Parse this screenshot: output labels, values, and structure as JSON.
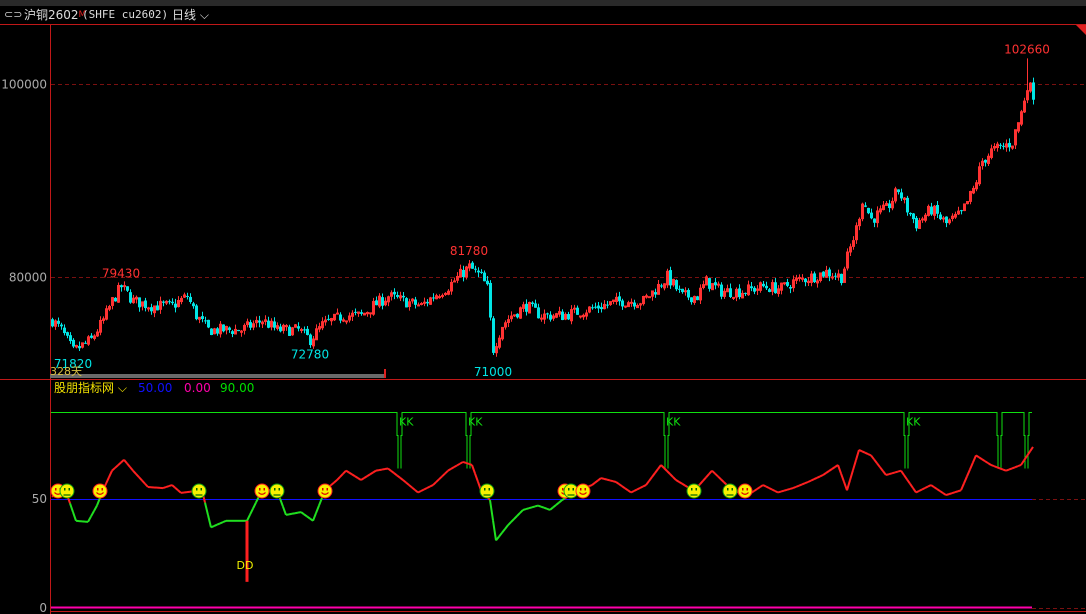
{
  "header": {
    "link_icon": "link-icon",
    "name": "沪铜2602",
    "flag": "M",
    "code": "(SHFE cu2602)",
    "period": "日线",
    "period_icon": "chevron-down-icon"
  },
  "main_chart": {
    "type": "candlestick",
    "y_ticks": [
      {
        "label": "100000",
        "value": 100000
      },
      {
        "label": "80000",
        "value": 80000
      }
    ],
    "ylim": [
      70500,
      103500
    ],
    "days": 328,
    "day_count_label": "328天",
    "colors": {
      "up": "#ff3232",
      "down": "#00e5e5",
      "grid": "#7a1010",
      "axis": "#c01818"
    },
    "annotations": [
      {
        "label": "79430",
        "day": 23,
        "value": 79430,
        "color": "#ff3232"
      },
      {
        "label": "71820",
        "day": 7,
        "value": 71820,
        "color": "#00e5e5"
      },
      {
        "label": "72780",
        "day": 86,
        "value": 72780,
        "color": "#00e5e5"
      },
      {
        "label": "81780",
        "day": 139,
        "value": 81780,
        "color": "#ff3232"
      },
      {
        "label": "71000",
        "day": 147,
        "value": 71000,
        "color": "#00e5e5"
      },
      {
        "label": "102660",
        "day": 325,
        "value": 102660,
        "color": "#ff3232"
      }
    ],
    "close_path": [
      [
        0,
        75500
      ],
      [
        3,
        74500
      ],
      [
        7,
        72300
      ],
      [
        13,
        73500
      ],
      [
        17,
        75500
      ],
      [
        20,
        77500
      ],
      [
        23,
        79000
      ],
      [
        27,
        77500
      ],
      [
        33,
        77000
      ],
      [
        40,
        77000
      ],
      [
        45,
        78000
      ],
      [
        48,
        76000
      ],
      [
        52,
        74500
      ],
      [
        57,
        74500
      ],
      [
        63,
        74500
      ],
      [
        70,
        75500
      ],
      [
        75,
        74500
      ],
      [
        82,
        74500
      ],
      [
        86,
        73500
      ],
      [
        90,
        75000
      ],
      [
        97,
        76000
      ],
      [
        103,
        76000
      ],
      [
        107,
        77000
      ],
      [
        112,
        78000
      ],
      [
        117,
        77500
      ],
      [
        123,
        77000
      ],
      [
        127,
        78000
      ],
      [
        132,
        79000
      ],
      [
        137,
        80500
      ],
      [
        139,
        81000
      ],
      [
        143,
        80000
      ],
      [
        145,
        78800
      ],
      [
        146,
        75500
      ],
      [
        147,
        72500
      ],
      [
        150,
        75000
      ],
      [
        153,
        76000
      ],
      [
        158,
        77000
      ],
      [
        163,
        76000
      ],
      [
        170,
        76000
      ],
      [
        177,
        76500
      ],
      [
        183,
        77000
      ],
      [
        190,
        77500
      ],
      [
        197,
        77500
      ],
      [
        202,
        79000
      ],
      [
        205,
        80000
      ],
      [
        210,
        78000
      ],
      [
        215,
        78000
      ],
      [
        218,
        79500
      ],
      [
        223,
        78500
      ],
      [
        230,
        78500
      ],
      [
        237,
        79000
      ],
      [
        243,
        78800
      ],
      [
        247,
        79500
      ],
      [
        253,
        80000
      ],
      [
        258,
        80500
      ],
      [
        263,
        80000
      ],
      [
        265,
        82000
      ],
      [
        268,
        85000
      ],
      [
        270,
        88000
      ],
      [
        273,
        86000
      ],
      [
        278,
        87000
      ],
      [
        282,
        89000
      ],
      [
        285,
        87000
      ],
      [
        288,
        85500
      ],
      [
        293,
        87000
      ],
      [
        298,
        85500
      ],
      [
        303,
        86500
      ],
      [
        307,
        89000
      ],
      [
        310,
        92000
      ],
      [
        313,
        93000
      ],
      [
        317,
        93500
      ],
      [
        320,
        94000
      ],
      [
        323,
        97000
      ],
      [
        325,
        100000
      ],
      [
        327,
        99000
      ]
    ]
  },
  "indicator": {
    "name": "股朋指标网",
    "dropdown_icon": "chevron-down-icon",
    "params": [
      {
        "value": "50.00",
        "color": "#1010ff"
      },
      {
        "value": "0.00",
        "color": "#ff00aa"
      },
      {
        "value": "90.00",
        "color": "#00e000"
      }
    ],
    "y_ticks": [
      {
        "label": "50",
        "value": 50
      },
      {
        "label": "0",
        "value": 0
      }
    ],
    "ylim": [
      0,
      100
    ],
    "line_color_above": "#ff2020",
    "line_color_below": "#20e020",
    "values": [
      [
        0,
        51
      ],
      [
        2,
        54
      ],
      [
        5,
        52
      ],
      [
        8,
        40
      ],
      [
        12,
        39.5
      ],
      [
        15,
        47
      ],
      [
        17,
        54
      ],
      [
        20,
        63
      ],
      [
        24,
        68
      ],
      [
        27,
        63
      ],
      [
        32,
        55.5
      ],
      [
        37,
        55
      ],
      [
        40,
        56.4
      ],
      [
        43,
        52.8
      ],
      [
        50,
        54
      ],
      [
        53,
        37
      ],
      [
        58,
        40
      ],
      [
        65,
        40
      ],
      [
        70,
        54
      ],
      [
        75,
        54
      ],
      [
        78,
        42.7
      ],
      [
        83,
        44
      ],
      [
        87,
        40
      ],
      [
        91,
        54
      ],
      [
        95,
        58.7
      ],
      [
        98,
        63
      ],
      [
        103,
        58.7
      ],
      [
        108,
        63
      ],
      [
        112,
        64
      ],
      [
        117,
        58.7
      ],
      [
        122,
        53
      ],
      [
        127,
        56.4
      ],
      [
        132,
        63
      ],
      [
        137,
        67
      ],
      [
        140,
        65.6
      ],
      [
        143,
        54
      ],
      [
        146,
        49.5
      ],
      [
        148,
        31
      ],
      [
        152,
        38
      ],
      [
        157,
        45
      ],
      [
        162,
        47
      ],
      [
        166,
        45
      ],
      [
        170,
        49.5
      ],
      [
        175,
        53.7
      ],
      [
        180,
        56.4
      ],
      [
        183,
        59.6
      ],
      [
        188,
        57.8
      ],
      [
        193,
        53
      ],
      [
        198,
        56.4
      ],
      [
        203,
        65.6
      ],
      [
        208,
        58.7
      ],
      [
        214,
        53.7
      ],
      [
        220,
        63
      ],
      [
        227,
        53.7
      ],
      [
        232,
        51.8
      ],
      [
        237,
        56.4
      ],
      [
        242,
        53
      ],
      [
        247,
        55
      ],
      [
        252,
        57.8
      ],
      [
        257,
        61
      ],
      [
        262,
        65.6
      ],
      [
        265,
        54
      ],
      [
        269,
        72.5
      ],
      [
        273,
        70
      ],
      [
        278,
        61
      ],
      [
        283,
        63
      ],
      [
        288,
        53
      ],
      [
        293,
        56.4
      ],
      [
        298,
        51.8
      ],
      [
        303,
        54
      ],
      [
        308,
        70
      ],
      [
        313,
        65.6
      ],
      [
        318,
        63
      ],
      [
        323,
        65.6
      ],
      [
        327,
        73.9
      ]
    ],
    "kk_signals": [
      {
        "day": 116,
        "label": "KK"
      },
      {
        "day": 139,
        "label": "KK"
      },
      {
        "day": 205,
        "label": "KK"
      },
      {
        "day": 285,
        "label": "KK"
      },
      {
        "day": 316,
        "label": ""
      },
      {
        "day": 325,
        "label": ""
      }
    ],
    "dd_signal": {
      "day": 65,
      "label": "DD",
      "from": 40,
      "to": 12
    },
    "smileys": [
      [
        2,
        "happy"
      ],
      [
        5,
        "sad"
      ],
      [
        16,
        "happy"
      ],
      [
        49,
        "sad"
      ],
      [
        70,
        "happy"
      ],
      [
        75,
        "sad"
      ],
      [
        91,
        "happy"
      ],
      [
        145,
        "sad"
      ],
      [
        171,
        "happy"
      ],
      [
        173,
        "sad"
      ],
      [
        177,
        "happy"
      ],
      [
        214,
        "sad"
      ],
      [
        226,
        "sad"
      ],
      [
        231,
        "happy"
      ]
    ]
  }
}
